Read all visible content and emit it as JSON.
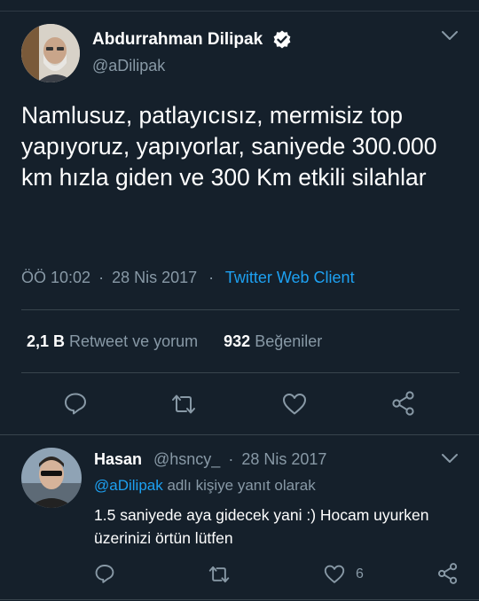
{
  "tweet": {
    "author_name": "Abdurrahman Dilipak",
    "handle": "@aDilipak",
    "text": "Namlusuz, patlayıcısız, mermisiz top yapıyoruz, yapıyorlar, saniyede 300.000 km hızla giden ve 300 Km etkili silahlar",
    "time": "ÖÖ 10:02",
    "date": "28 Nis 2017",
    "separator": "·",
    "client": "Twitter Web Client",
    "retweets_count": "2,1 B",
    "retweets_label": "Retweet ve yorum",
    "likes_count": "932",
    "likes_label": "Beğeniler"
  },
  "reply": {
    "author_name": "Hasan",
    "handle": "@hsncy_",
    "separator": "·",
    "date": "28 Nis 2017",
    "reply_to_handle": "@aDilipak",
    "reply_to_suffix": "adlı kişiye yanıt olarak",
    "text": "1.5 saniyede aya gidecek yani :) Hocam uyurken üzerinizi örtün lütfen",
    "like_count": "6"
  },
  "colors": {
    "background": "#15202b",
    "text": "#ffffff",
    "muted": "#8899a6",
    "accent": "#1da1f2",
    "divider": "#38444d"
  },
  "icons": [
    "verified-badge-icon",
    "chevron-down-icon",
    "reply-icon",
    "retweet-icon",
    "like-icon",
    "share-icon"
  ]
}
